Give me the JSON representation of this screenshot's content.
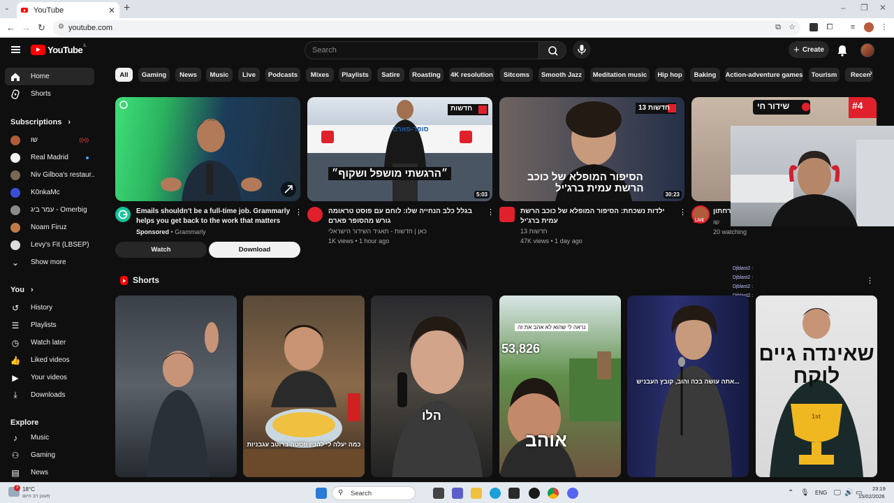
{
  "browser": {
    "tab_title": "YouTube",
    "url": "youtube.com"
  },
  "header": {
    "logo_text": "YouTube",
    "logo_country": "IL",
    "search_placeholder": "Search",
    "create_label": "Create"
  },
  "sidebar": {
    "main": [
      {
        "label": "Home",
        "icon": "home-icon",
        "active": true
      },
      {
        "label": "Shorts",
        "icon": "shorts-icon",
        "active": false
      }
    ],
    "subscriptions_title": "Subscriptions",
    "subscriptions": [
      {
        "label": "שו",
        "color": "#b05c3a"
      },
      {
        "label": "Real Madrid",
        "color": "#f2f2f2"
      },
      {
        "label": "Niv Gilboa's restaur...",
        "color": "#7a6a55"
      },
      {
        "label": "K0nkaMc",
        "color": "#3a4fd6"
      },
      {
        "label": "עמר ביג - Omerbig",
        "color": "#8a8a8a"
      },
      {
        "label": "Noam Firuz",
        "color": "#c07a4a"
      },
      {
        "label": "Levy's Fit (LBSEP)",
        "color": "#dcdcdc"
      }
    ],
    "show_more": "Show more",
    "you_title": "You",
    "you_items": [
      {
        "label": "History",
        "icon": "history-icon"
      },
      {
        "label": "Playlists",
        "icon": "playlists-icon"
      },
      {
        "label": "Watch later",
        "icon": "watch-later-icon"
      },
      {
        "label": "Liked videos",
        "icon": "like-icon"
      },
      {
        "label": "Your videos",
        "icon": "your-videos-icon"
      },
      {
        "label": "Downloads",
        "icon": "download-icon"
      }
    ],
    "explore_title": "Explore",
    "explore_items": [
      {
        "label": "Music",
        "icon": "music-icon"
      },
      {
        "label": "Gaming",
        "icon": "gaming-icon"
      },
      {
        "label": "News",
        "icon": "news-icon"
      }
    ]
  },
  "chips": [
    "All",
    "Gaming",
    "News",
    "Music",
    "Live",
    "Podcasts",
    "Mixes",
    "Playlists",
    "Satire",
    "Roasting",
    "4K resolution",
    "Sitcoms",
    "Smooth Jazz",
    "Meditation music",
    "Hip hop",
    "Baking",
    "Action-adventure games",
    "Tourism",
    "Recen"
  ],
  "videos": [
    {
      "title": "Emails shouldn't be a full-time job. Grammarly helps you get back to the work that matters",
      "sponsored": "Sponsored",
      "channel": "Grammarly",
      "watch_label": "Watch",
      "download_label": "Download"
    },
    {
      "title": "בגלל כלב הנחייה שלו: לוחם עם פוסט טראומה גורש מהסופר פארם",
      "channel": "כאן | חדשות - תאגיד השידור הישראלי",
      "meta": "1K views • 1 hour ago",
      "duration": "5:03",
      "thumb_caption": "״הרגשתי מושפל ושקוף״",
      "thumb_badge": "חדשות",
      "thumb_store": "סופר-פארם"
    },
    {
      "title": "ילדות נשכחת: הסיפור המופלא של כוכב הרשת עמית ברג'יל",
      "channel": "חדשות 13",
      "meta": "47K views • 1 day ago",
      "duration": "30:23",
      "thumb_caption_1": "הסיפור המופלא של כוכב",
      "thumb_caption_2": "הרשת עמית ברג'יל",
      "thumb_badge": "חדשות 13"
    },
    {
      "title": "רחתון)",
      "channel": "שו",
      "meta": "20 watching",
      "thumb_badge": "שידור חי",
      "thumb_number": "#4",
      "live_label": "LIVE"
    }
  ],
  "shorts": {
    "title": "Shorts",
    "items": [
      {
        "caption": ""
      },
      {
        "caption": "כמה יעלה לי להכין פסטה ברוטב עגבניות"
      },
      {
        "caption": "הלו"
      },
      {
        "caption": "אוהב",
        "top_text": "נראה לי שהוא לא אהב את זה",
        "count": "53,826"
      },
      {
        "caption": "אתה עושה בכה והוב, קובץ העבניש..."
      },
      {
        "caption": "שאינדה גיים לוקח",
        "trophy": "1st"
      }
    ]
  },
  "stream_chat": [
    "Djblast2 :",
    "Djblast2 :",
    "Djblast2 :",
    "Djblast2 :"
  ],
  "taskbar": {
    "temperature": "18°C",
    "weather": "מעונן רב היום",
    "search_label": "Search",
    "lang": "ENG",
    "time": "23:19",
    "date": "15/02/2026",
    "weather_badge": "3"
  }
}
